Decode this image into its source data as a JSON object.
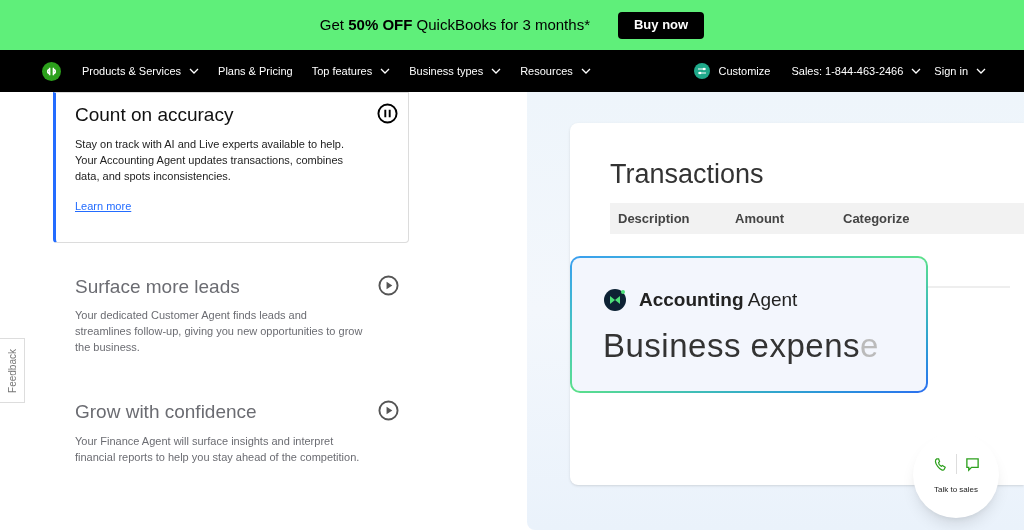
{
  "promo_banner": {
    "text": "Get **50% OFF** QuickBooks for 3 months*",
    "button": "Buy now"
  },
  "nav": {
    "items": [
      {
        "label": "Products & Services",
        "dropdown": true
      },
      {
        "label": "Plans & Pricing",
        "dropdown": false
      },
      {
        "label": "Top features",
        "dropdown": true
      },
      {
        "label": "Business types",
        "dropdown": true
      },
      {
        "label": "Resources",
        "dropdown": true
      }
    ],
    "customize": "Customize",
    "sales": "Sales: 1-844-463-2466",
    "sign_in": "Sign in"
  },
  "features": [
    {
      "title": "Count on accuracy",
      "body": "Stay on track with AI and Live experts available to help. Your Accounting Agent updates transactions, combines data, and spots inconsistencies.",
      "link": "Learn more",
      "selected": true
    },
    {
      "title": "Surface more leads",
      "body": "Your dedicated Customer Agent finds leads and streamlines follow-up, giving you new opportunities to grow the business.",
      "selected": false
    },
    {
      "title": "Grow with confidence",
      "body": "Your Finance Agent will surface insights and interpret financial reports to help you stay ahead of the competition.",
      "selected": false
    }
  ],
  "feedback_tab": "Feedback",
  "preview": {
    "title": "Transactions",
    "columns": [
      "Description",
      "Amount",
      "Categorize"
    ],
    "agent_card": {
      "name": "**Accounting** Agent",
      "typed_text": "Business expens",
      "fading_text": "e"
    }
  },
  "talk_to_sales": "Talk to sales"
}
